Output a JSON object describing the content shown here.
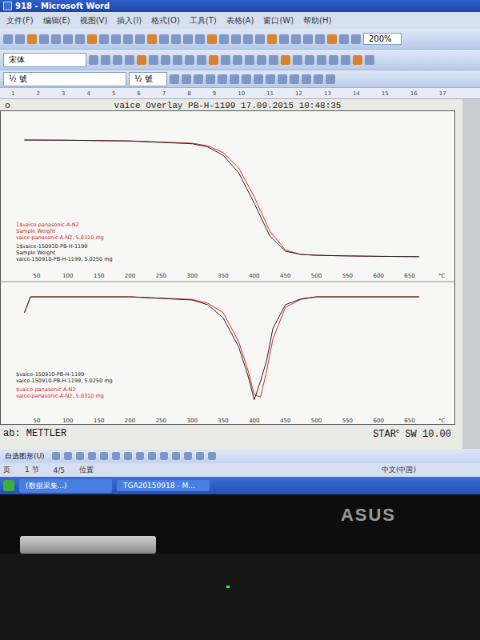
{
  "window": {
    "title": "918 - Microsoft Word"
  },
  "menu": [
    "文件(F)",
    "编辑(E)",
    "视图(V)",
    "插入(I)",
    "格式(O)",
    "工具(T)",
    "表格(A)",
    "窗口(W)",
    "帮助(H)"
  ],
  "toolbar": {
    "zoom": "200%",
    "font": "宋体",
    "size": "½ 號",
    "size2": "½ 號"
  },
  "ruler": [
    "1",
    "2",
    "3",
    "4",
    "5",
    "6",
    "7",
    "8",
    "9",
    "10",
    "11",
    "12",
    "13",
    "14",
    "15",
    "16",
    "17"
  ],
  "document": {
    "header_left": "o",
    "header": "vaice Overlay PB-H-1199   17.09.2015 10:48:35",
    "chart": {
      "x_ticks": [
        "50",
        "100",
        "150",
        "200",
        "250",
        "300",
        "350",
        "400",
        "450",
        "500",
        "550",
        "600",
        "650"
      ],
      "x_unit": "°C",
      "temperatures": [
        30,
        100,
        200,
        300,
        325,
        350,
        375,
        400,
        425,
        450,
        475,
        500,
        550,
        600,
        650,
        665
      ],
      "tga_series": [
        {
          "name": "red",
          "color": "#d42a2a",
          "values": [
            100,
            99.8,
            99.3,
            97.5,
            95.5,
            90,
            78,
            55,
            28,
            13,
            9.5,
            8.8,
            8.3,
            8,
            7.8,
            7.7
          ]
        },
        {
          "name": "black",
          "color": "#222222",
          "values": [
            100,
            99.8,
            99.2,
            97,
            94.5,
            88,
            74,
            50,
            24,
            12,
            9.5,
            8.8,
            8.3,
            8,
            7.8,
            7.7
          ]
        }
      ],
      "dtg_temperatures": [
        30,
        40,
        50,
        100,
        200,
        300,
        325,
        350,
        375,
        390,
        400,
        410,
        420,
        430,
        450,
        475,
        500,
        550,
        600,
        650,
        665
      ],
      "dtg_series": [
        {
          "name": "red",
          "color": "#d42a2a",
          "values": [
            -0.3,
            0,
            0,
            0,
            0,
            -0.05,
            -0.12,
            -0.3,
            -0.85,
            -1.4,
            -1.85,
            -1.9,
            -1.4,
            -0.8,
            -0.2,
            -0.05,
            0,
            0,
            0,
            0,
            0
          ]
        },
        {
          "name": "black",
          "color": "#222222",
          "values": [
            -0.3,
            0,
            0,
            0,
            0,
            -0.06,
            -0.15,
            -0.4,
            -0.95,
            -1.5,
            -1.95,
            -1.6,
            -1.2,
            -0.6,
            -0.15,
            -0.04,
            0,
            0,
            0,
            0,
            0
          ]
        }
      ],
      "tga_legend": [
        {
          "text": "1$vaice-panasonic-A-N2",
          "color": "#d42a2a"
        },
        {
          "text": "Sample Weight",
          "color": "#d42a2a"
        },
        {
          "text": "vaice-panasonic-A-N2, 5.0310 mg",
          "color": "#d42a2a"
        },
        {
          "text": "1$vaice-150910-PB-H-1199",
          "color": "#222222"
        },
        {
          "text": "Sample Weight",
          "color": "#222222"
        },
        {
          "text": "vaice-150910-PB-H-1199, 5.0250 mg",
          "color": "#222222"
        }
      ],
      "dtg_legend": [
        {
          "text": "$vaice-150910-PB-H-1199",
          "color": "#222222"
        },
        {
          "text": "vaice-150910-PB-H-1199, 5.0250 mg",
          "color": "#222222"
        },
        {
          "text": "$vaice-panasonic-A-N2",
          "color": "#d42a2a"
        },
        {
          "text": "vaice-panasonic-A-N2, 5.0310 mg",
          "color": "#d42a2a"
        }
      ]
    },
    "footer_left": "ab: METTLER",
    "footer_right": {
      "brand": "STAR",
      "sup": "e",
      "version": "SW 10.00"
    }
  },
  "drawing_bar": {
    "autoshapes": "自选图形(U)"
  },
  "status_bar": {
    "page": "页",
    "section": "1 节",
    "pages": "4/5",
    "position": "位置",
    "language": "中文(中国)"
  },
  "taskbar": [
    "(数据采集...)",
    "TGA20150918 - M..."
  ],
  "laptop": {
    "logo": "ASUS"
  }
}
